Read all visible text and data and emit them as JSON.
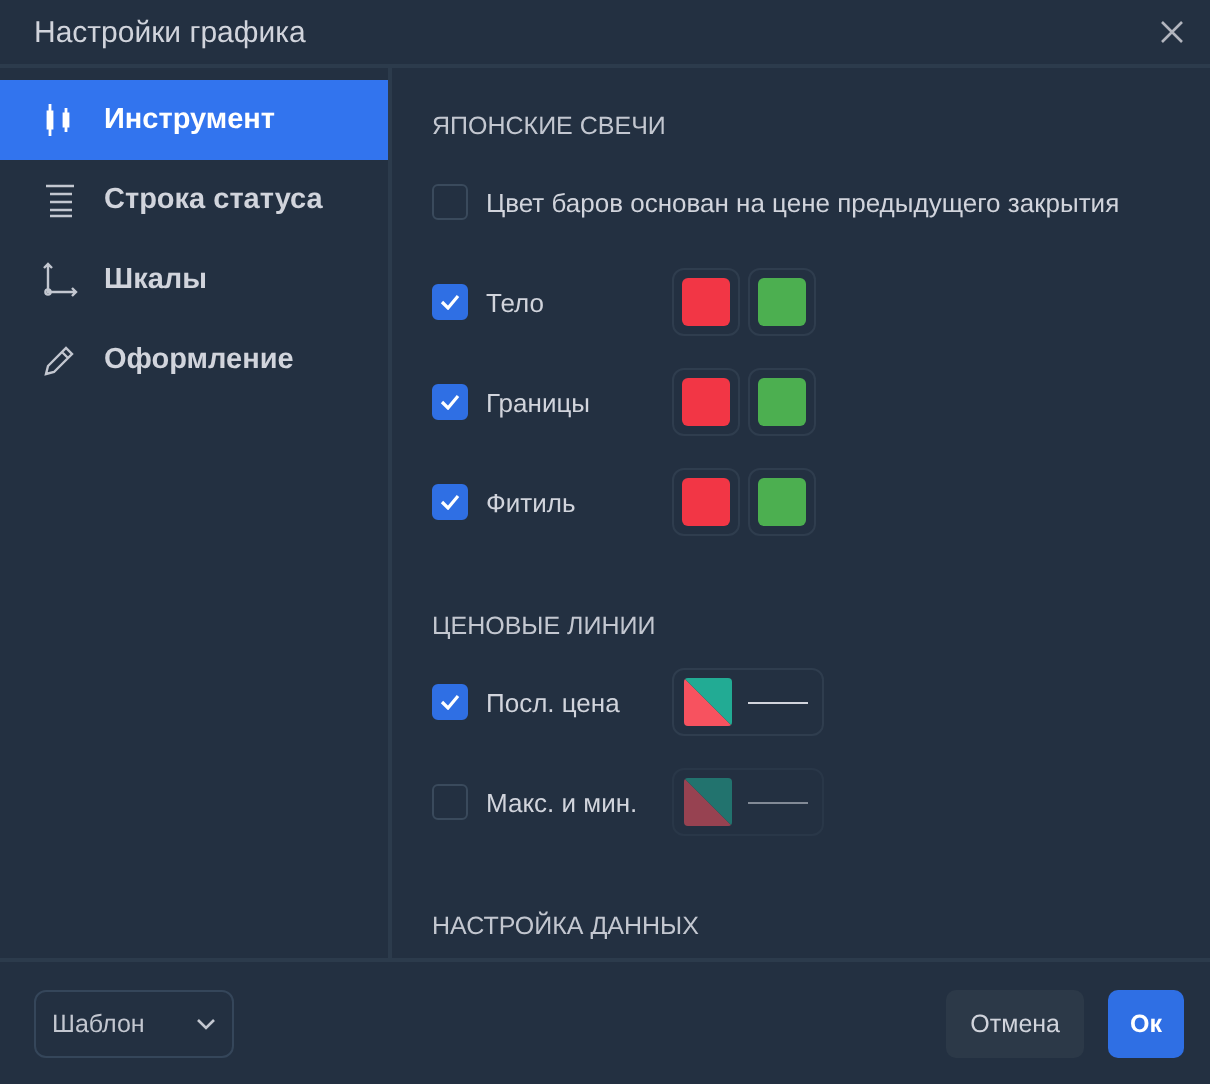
{
  "window": {
    "title": "Настройки графика"
  },
  "sidebar": {
    "items": [
      {
        "label": "Инструмент",
        "selected": true
      },
      {
        "label": "Строка статуса",
        "selected": false
      },
      {
        "label": "Шкалы",
        "selected": false
      },
      {
        "label": "Оформление",
        "selected": false
      }
    ]
  },
  "sections": [
    {
      "title": "ЯПОНСКИЕ СВЕЧИ",
      "rows": [
        {
          "kind": "check",
          "label": "Цвет баров основан на цене предыдущего закрытия",
          "checked": false
        },
        {
          "kind": "swatches",
          "label": "Тело",
          "checked": true
        },
        {
          "kind": "swatches",
          "label": "Границы",
          "checked": true
        },
        {
          "kind": "swatches",
          "label": "Фитиль",
          "checked": true
        }
      ]
    },
    {
      "title": "ЦЕНОВЫЕ ЛИНИИ",
      "rows": [
        {
          "kind": "line",
          "label": "Посл. цена",
          "checked": true
        },
        {
          "kind": "line",
          "label": "Макс. и мин.",
          "checked": false
        }
      ]
    },
    {
      "title": "НАСТРОЙКА ДАННЫХ"
    }
  ],
  "footer": {
    "template": "Шаблон",
    "buttons": [
      {
        "label": "Отмена",
        "kind": "secondary"
      },
      {
        "label": "Ок",
        "kind": "primary"
      }
    ]
  }
}
